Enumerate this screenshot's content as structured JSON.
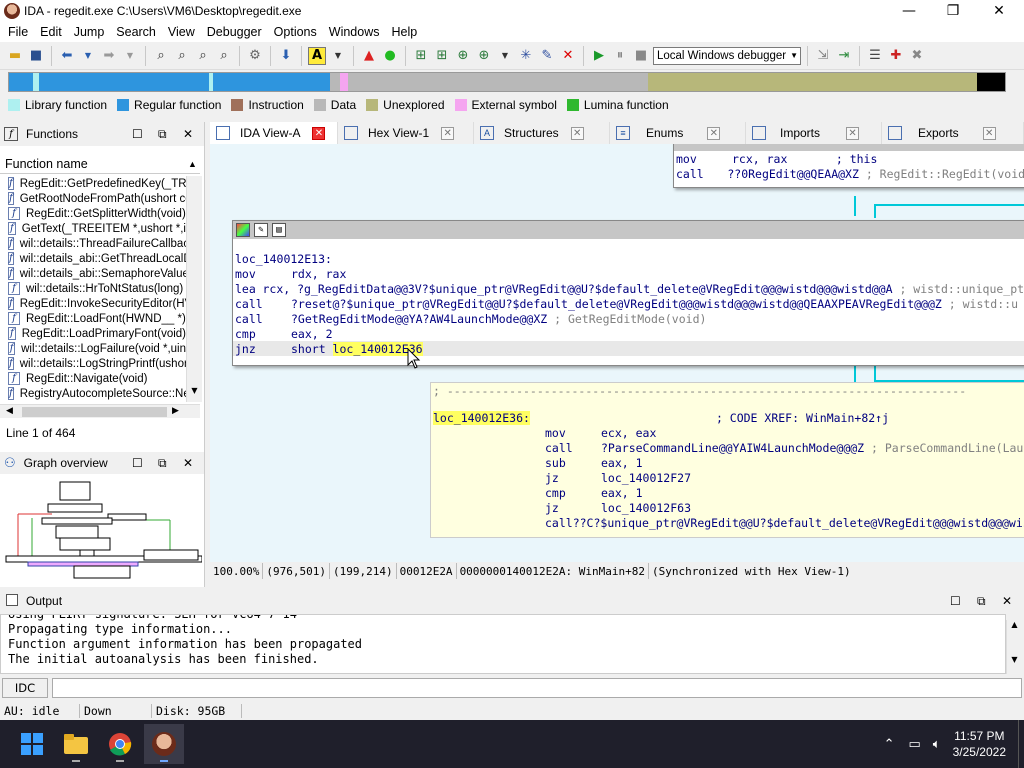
{
  "window": {
    "title": "IDA - regedit.exe C:\\Users\\VM6\\Desktop\\regedit.exe",
    "minimize": "—",
    "maximize": "❐",
    "close": "✕"
  },
  "menu": [
    "File",
    "Edit",
    "Jump",
    "Search",
    "View",
    "Debugger",
    "Options",
    "Windows",
    "Help"
  ],
  "toolbar": {
    "debugger_select": "Local Windows debugger"
  },
  "legend": [
    {
      "label": "Library function",
      "color": "#aef0f0"
    },
    {
      "label": "Regular function",
      "color": "#2e95de"
    },
    {
      "label": "Instruction",
      "color": "#a0705a"
    },
    {
      "label": "Data",
      "color": "#b8b8b8"
    },
    {
      "label": "Unexplored",
      "color": "#b7b77a"
    },
    {
      "label": "External symbol",
      "color": "#f5a5f0"
    },
    {
      "label": "Lumina function",
      "color": "#2eb82e"
    }
  ],
  "functions_panel": {
    "title": "Functions",
    "column": "Function name",
    "items": [
      "RegEdit::GetPredefinedKey(_TRE",
      "GetRootNodeFromPath(ushort co",
      "RegEdit::GetSplitterWidth(void)",
      "GetText(_TREEITEM *,ushort *,i",
      "wil::details::ThreadFailureCallbac",
      "wil::details_abi::GetThreadLocalD",
      "wil::details_abi::SemaphoreValue",
      "wil::details::HrToNtStatus(long)",
      "RegEdit::InvokeSecurityEditor(HV",
      "RegEdit::LoadFont(HWND__ *)",
      "RegEdit::LoadPrimaryFont(void)",
      "wil::details::LogFailure(void *,uin",
      "wil::details::LogStringPrintf(ushor",
      "RegEdit::Navigate(void)",
      "RegistryAutocompleteSource::Ne"
    ],
    "status": "Line 1 of 464"
  },
  "graph_overview": {
    "title": "Graph overview"
  },
  "tabs": [
    {
      "label": "IDA View-A",
      "icon": "IDA",
      "active": true
    },
    {
      "label": "Hex View-1",
      "icon": "HX"
    },
    {
      "label": "Structures",
      "icon": "A"
    },
    {
      "label": "Enums",
      "icon": "≡"
    },
    {
      "label": "Imports",
      "icon": "IM"
    },
    {
      "label": "Exports",
      "icon": "EX"
    }
  ],
  "graph": {
    "top_node": [
      {
        "m": "mov",
        "o": "rcx, rax",
        "c": "       ; this"
      },
      {
        "m": "call",
        "o": "??0RegEdit@@QEAA@XZ",
        "c": " ; RegEdit::RegEdit(void)"
      }
    ],
    "mid_node": {
      "label": "loc_140012E13:",
      "lines": [
        {
          "m": "mov",
          "o": "rdx, rax",
          "c": ""
        },
        {
          "m": "lea",
          "o": "rcx, ?g_RegEditData@@3V?$unique_ptr@VRegEdit@@U?$default_delete@VRegEdit@@@wistd@@@wistd@@A",
          "c": " ; wistd::unique_ptr"
        },
        {
          "m": "call",
          "o": "?reset@?$unique_ptr@VRegEdit@@U?$default_delete@VRegEdit@@@wistd@@@wistd@@QEAAXPEAVRegEdit@@@Z",
          "c": " ; wistd::u"
        },
        {
          "m": "call",
          "o": "?GetRegEditMode@@YA?AW4LaunchMode@@XZ",
          "c": " ; GetRegEditMode(void)"
        },
        {
          "m": "cmp",
          "o": "eax, 2",
          "c": ""
        },
        {
          "m": "jnz",
          "o": "short ",
          "target": "loc_140012E36",
          "c": ""
        }
      ]
    },
    "bottom_node": {
      "separator": "; ---------------------------------------------------------------------------",
      "label": "loc_140012E36:",
      "xref": "; CODE XREF: WinMain+82↑j",
      "lines": [
        {
          "m": "mov",
          "o": "ecx, eax",
          "c": ""
        },
        {
          "m": "call",
          "o": "?ParseCommandLine@@YAIW4LaunchMode@@@Z",
          "c": " ; ParseCommandLine(Lau"
        },
        {
          "m": "sub",
          "o": "eax, 1",
          "c": ""
        },
        {
          "m": "jz",
          "o": "loc_140012F27",
          "c": ""
        },
        {
          "m": "cmp",
          "o": "eax, 1",
          "c": ""
        },
        {
          "m": "jz",
          "o": "loc_140012F63",
          "c": ""
        },
        {
          "m": "call",
          "o": "??C?$unique_ptr@VRegEdit@@U?$default_delete@VRegEdit@@@wistd@@@wistd@@",
          "c": ""
        }
      ]
    },
    "status": [
      "100.00%",
      "(976,501)",
      "(199,214)",
      "00012E2A",
      "0000000140012E2A: WinMain+82",
      "(Synchronized with Hex View-1)"
    ]
  },
  "output": {
    "title": "Output",
    "lines": [
      "Using FLIRT signature: SEH for vc64 7-14",
      "Propagating type information...",
      "Function argument information has been propagated",
      "The initial autoanalysis has been finished."
    ],
    "idc_label": "IDC"
  },
  "statusbar": {
    "au": "AU:  idle",
    "dir": "Down",
    "disk": "Disk: 95GB"
  },
  "taskbar": {
    "time": "11:57 PM",
    "date": "3/25/2022"
  }
}
